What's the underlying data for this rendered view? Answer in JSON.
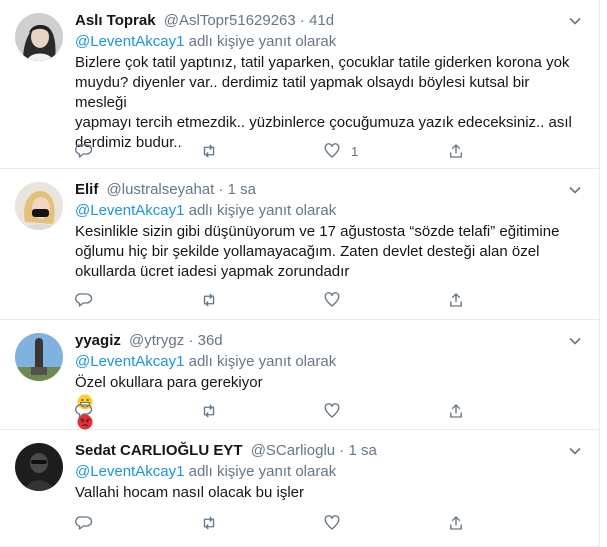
{
  "reply_prefix": "adlı kişiye yanıt olarak",
  "tweets": [
    {
      "name": "Aslı Toprak",
      "handle": "@AslTopr51629263",
      "dot": "·",
      "time": "41d",
      "mention": "@LeventAkcay1",
      "text": "Bizlere çok tatil yaptınız, tatil yaparken, çocuklar tatile giderken korona yok\nmuydu? diyenler var.. derdimiz tatil yapmak olsaydı böylesi kutsal bir mesleği\nyapmayı tercih etmezdik.. yüzbinlerce çocuğumuza yazık edeceksiniz.. asıl\nderdimiz budur..",
      "likes": "1"
    },
    {
      "name": "Elif",
      "handle": "@lustralseyahat",
      "dot": "·",
      "time": "1 sa",
      "mention": "@LeventAkcay1",
      "text": "Kesinlikle sizin gibi düşünüyorum ve 17 ağustosta “sözde telafi” eğitimine\noğlumu hiç bir şekilde yollamayacağım. Zaten devlet desteği alan özel\nokullarda ücret iadesi yapmak zorundadır",
      "likes": ""
    },
    {
      "name": "yyagiz",
      "handle": "@ytrygz",
      "dot": "·",
      "time": "36d",
      "mention": "@LeventAkcay1",
      "text": "Özel okullara para gerekiyor",
      "emojis": [
        "grinning-face-emoji",
        "angry-face-emoji"
      ],
      "likes": ""
    },
    {
      "name": "Sedat CARLIOĞLU EYT",
      "handle": "@SCarlioglu",
      "dot": "·",
      "time": "1 sa",
      "mention": "@LeventAkcay1",
      "text": "Vallahi hocam nasıl olacak bu işler",
      "likes": ""
    }
  ],
  "colors": {
    "text": "#14171a",
    "secondary": "#657786",
    "link": "#1b95e0",
    "border": "#e6ecf0"
  }
}
